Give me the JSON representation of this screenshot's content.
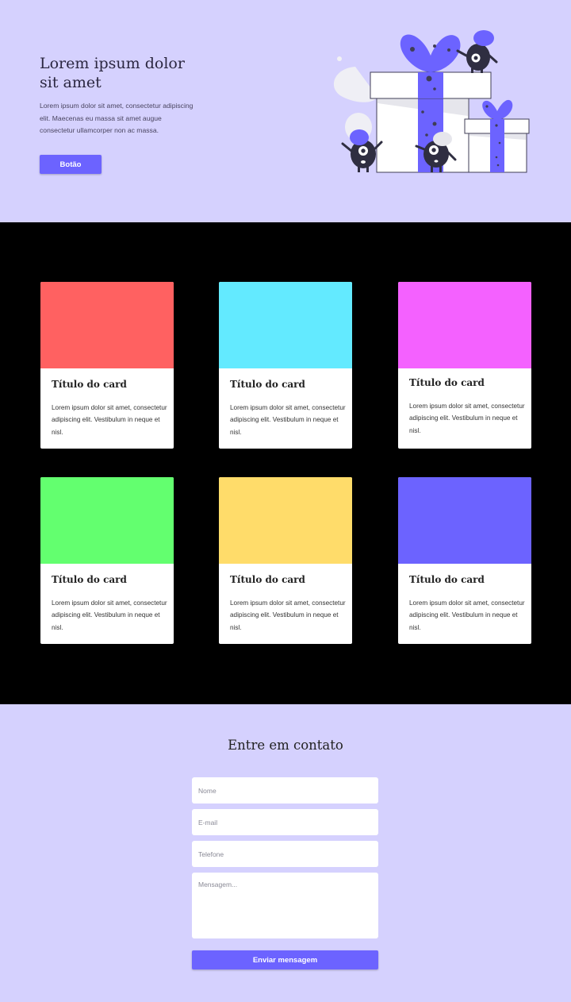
{
  "hero": {
    "title": "Lorem ipsum dolor sit amet",
    "text": "Lorem ipsum dolor sit amet, consectetur adipiscing elit. Maecenas eu massa sit amet augue consectetur ullamcorper non ac massa.",
    "button_label": "Botão",
    "illustration_icon": "gift-boxes-monsters-illustration"
  },
  "cards": [
    {
      "title": "Título do card",
      "text": "Lorem ipsum dolor sit amet, consectetur adipiscing elit. Vestibulum in neque et nisl.",
      "color": "#ff6161"
    },
    {
      "title": "Título do card",
      "text": "Lorem ipsum dolor sit amet, consectetur adipiscing elit. Vestibulum in neque et nisl.",
      "color": "#63eaff"
    },
    {
      "title": "Título do card",
      "text": "Lorem ipsum dolor sit amet, consectetur adipiscing elit. Vestibulum in neque et nisl.",
      "color": "#f461ff"
    },
    {
      "title": "Título do card",
      "text": "Lorem ipsum dolor sit amet, consectetur adipiscing elit. Vestibulum in neque et nisl.",
      "color": "#63ff6f"
    },
    {
      "title": "Título do card",
      "text": "Lorem ipsum dolor sit amet, consectetur adipiscing elit. Vestibulum in neque et nisl.",
      "color": "#ffdc6a"
    },
    {
      "title": "Título do card",
      "text": "Lorem ipsum dolor sit amet, consectetur adipiscing elit. Vestibulum in neque et nisl.",
      "color": "#6c63ff"
    }
  ],
  "contact": {
    "title": "Entre em contato",
    "name_placeholder": "Nome",
    "email_placeholder": "E-mail",
    "phone_placeholder": "Telefone",
    "message_placeholder": "Mensagem...",
    "submit_label": "Enviar mensagem"
  },
  "colors": {
    "accent": "#6c63ff",
    "background": "#d5d1fe",
    "cards_background": "#000000"
  }
}
